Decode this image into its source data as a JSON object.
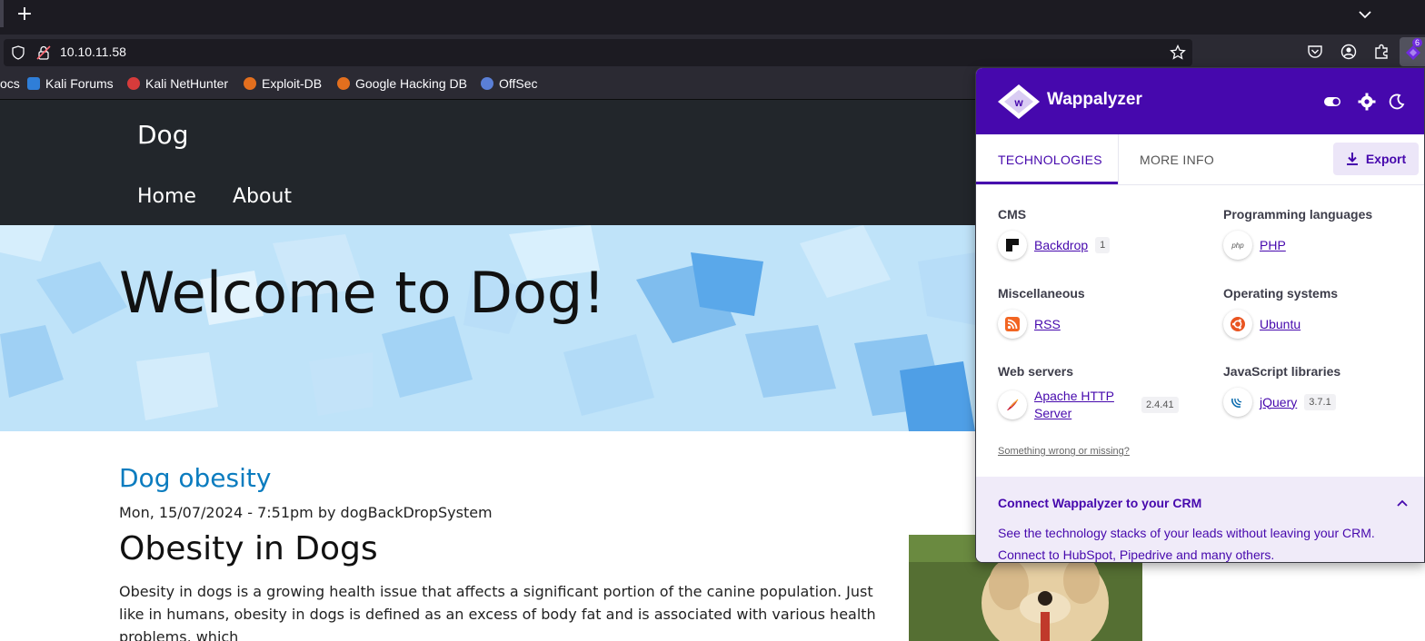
{
  "browser": {
    "url": "10.10.11.58",
    "extension_badge": "6",
    "bookmarks": [
      {
        "label": "ocs"
      },
      {
        "label": "Kali Forums"
      },
      {
        "label": "Kali NetHunter"
      },
      {
        "label": "Exploit-DB"
      },
      {
        "label": "Google Hacking DB"
      },
      {
        "label": "OffSec"
      }
    ]
  },
  "site": {
    "name": "Dog",
    "menu": [
      "Home",
      "About"
    ],
    "hero_title": "Welcome to Dog!",
    "post": {
      "title": "Dog obesity",
      "meta": "Mon, 15/07/2024 - 7:51pm by dogBackDropSystem",
      "heading": "Obesity in Dogs",
      "body": "Obesity in dogs is a growing health issue that affects a significant portion of the canine population. Just like in humans, obesity in dogs is defined as an excess of body fat and is associated with various health problems, which"
    }
  },
  "wappalyzer": {
    "title": "Wappalyzer",
    "tabs": [
      "TECHNOLOGIES",
      "MORE INFO"
    ],
    "export_label": "Export",
    "categories": [
      {
        "name": "CMS",
        "techs": [
          {
            "name": "Backdrop",
            "version": "1"
          }
        ]
      },
      {
        "name": "Programming languages",
        "techs": [
          {
            "name": "PHP",
            "version": ""
          }
        ]
      },
      {
        "name": "Miscellaneous",
        "techs": [
          {
            "name": "RSS",
            "version": ""
          }
        ]
      },
      {
        "name": "Operating systems",
        "techs": [
          {
            "name": "Ubuntu",
            "version": ""
          }
        ]
      },
      {
        "name": "Web servers",
        "techs": [
          {
            "name": "Apache HTTP Server",
            "version": "2.4.41"
          }
        ]
      },
      {
        "name": "JavaScript libraries",
        "techs": [
          {
            "name": "jQuery",
            "version": "3.7.1"
          }
        ]
      }
    ],
    "feedback_link": "Something wrong or missing?",
    "crm": {
      "title": "Connect Wappalyzer to your CRM",
      "body": "See the technology stacks of your leads without leaving your CRM. Connect to HubSpot, Pipedrive and many others."
    },
    "colors": {
      "brand": "#4608ad",
      "crm_bg": "#f0ebf9"
    }
  }
}
